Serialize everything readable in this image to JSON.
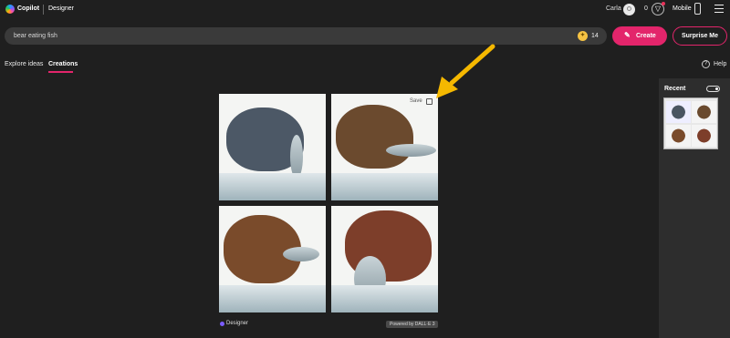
{
  "header": {
    "brand": "Copilot",
    "app": "Designer",
    "user": "Carla",
    "boosts": "0",
    "mobile_label": "Mobile"
  },
  "prompt": {
    "text": "bear eating fish",
    "coins": "14",
    "create_label": "Create",
    "surprise_label": "Surprise Me"
  },
  "tabs": [
    {
      "label": "Explore ideas"
    },
    {
      "label": "Creations"
    }
  ],
  "help_label": "Help",
  "grid": {
    "save_label": "Save"
  },
  "footer": {
    "brand": "Designer",
    "powered_by": "Powered by DALL·E 3"
  },
  "sidebar": {
    "recent_label": "Recent"
  },
  "colors": {
    "accent": "#e3256b",
    "coin": "#f6c343",
    "arrow": "#f5b800",
    "background": "#1f1f1f"
  },
  "icons": [
    "copilot-logo-icon",
    "user-avatar-icon",
    "reward-icon",
    "phone-icon",
    "hamburger-menu-icon",
    "coin-icon",
    "pencil-icon",
    "help-icon",
    "copy-icon",
    "toggle-icon",
    "arrow-annotation"
  ]
}
